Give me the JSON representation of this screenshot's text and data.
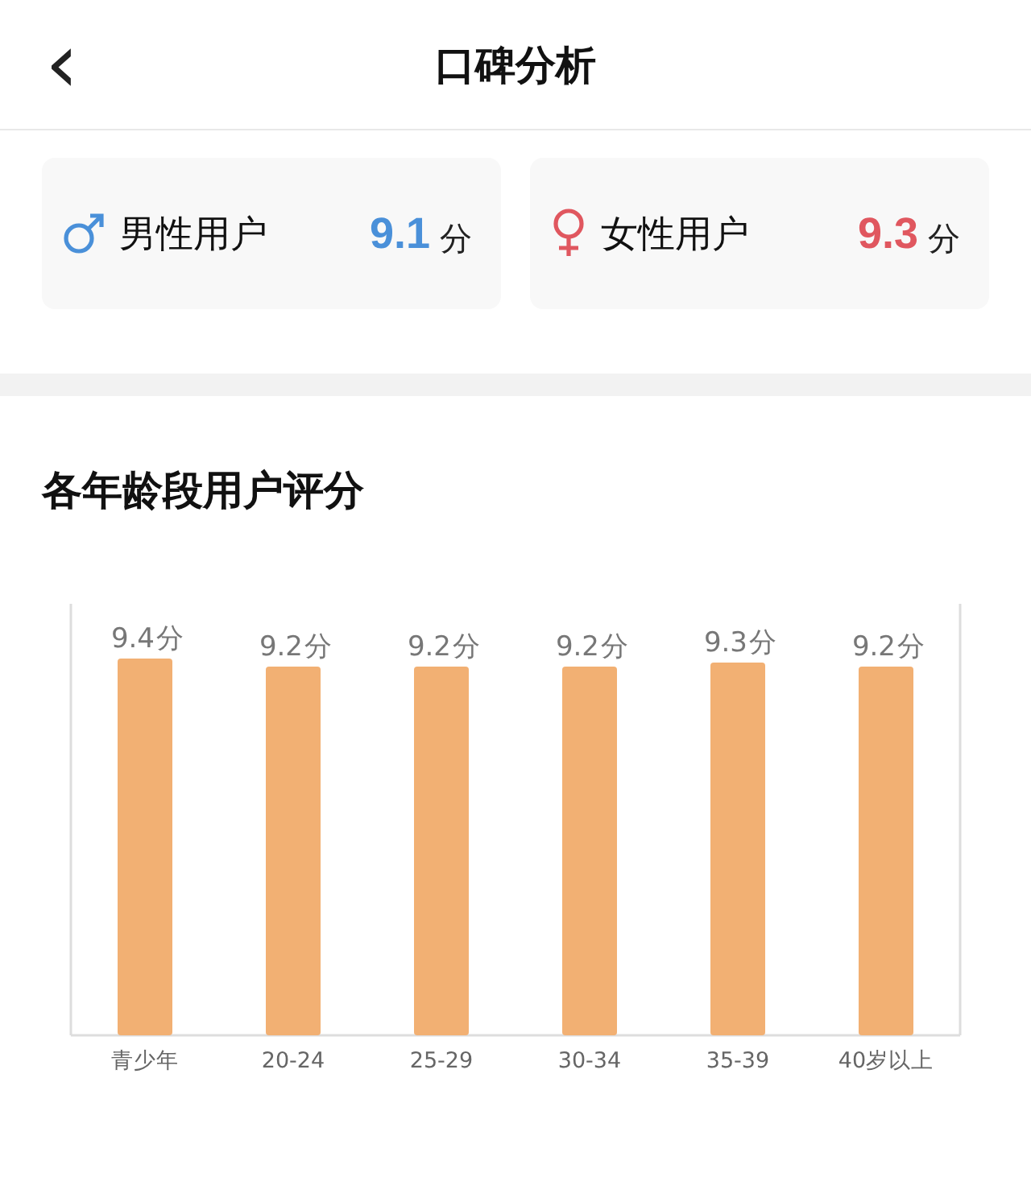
{
  "header": {
    "back": "‹",
    "title": "口碑分析"
  },
  "gender_cards": [
    {
      "kind": "male",
      "label": "男性用户",
      "score": "9.1",
      "unit": "分",
      "color": "#4a90d9"
    },
    {
      "kind": "female",
      "label": "女性用户",
      "score": "9.3",
      "unit": "分",
      "color": "#e0575f"
    }
  ],
  "age_section": {
    "title": "各年龄段用户评分",
    "chart_data": {
      "type": "bar",
      "categories": [
        "青少年",
        "20-24",
        "25-29",
        "30-34",
        "35-39",
        "40岁以上"
      ],
      "series": [
        {
          "color": "#f2b073",
          "values": [
            9.4,
            9.2,
            9.2,
            9.2,
            9.3,
            9.2
          ]
        }
      ],
      "data_labels": true
    },
    "bar_units": [
      "分",
      "分",
      "分",
      "分",
      "分",
      "分"
    ]
  }
}
